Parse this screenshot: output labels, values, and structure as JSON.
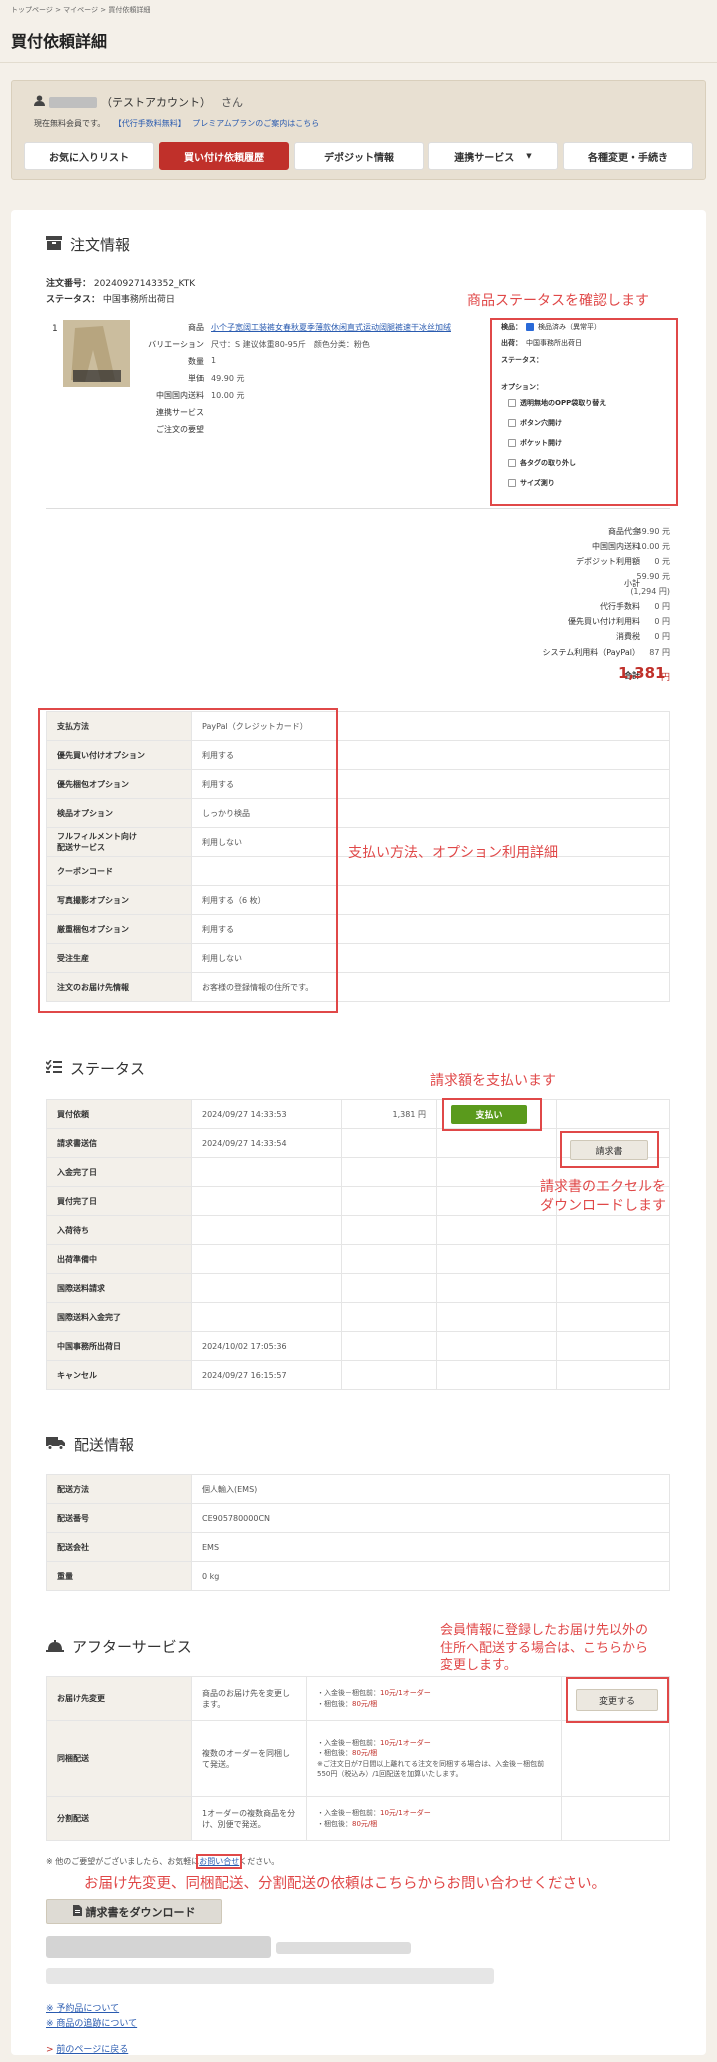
{
  "breadcrumb": "トップページ > マイページ > 買付依頼詳細",
  "page_title": "買付依頼詳細",
  "member": {
    "account_label": "（テストアカウント）",
    "honorific": "さん",
    "status_text": "現在無料会員です。",
    "fee_link": "【代行手数料無料】",
    "premium_link": "プレミアムプランのご案内はこちら"
  },
  "nav": [
    {
      "label": "お気に入りリスト"
    },
    {
      "label": "買い付け依頼履歴"
    },
    {
      "label": "デポジット情報"
    },
    {
      "label": "連携サービス"
    },
    {
      "label": "各種変更・手続き"
    }
  ],
  "order": {
    "section_title": "注文情報",
    "number_label": "注文番号：",
    "number": "20240927143352_KTK",
    "status_label": "ステータス：",
    "status": "中国事務所出荷日"
  },
  "product": {
    "index": "1",
    "labels": [
      "商品",
      "バリエーション",
      "数量",
      "単価",
      "中国国内送料",
      "連携サービス",
      "ご注文の要望"
    ],
    "name": "小个子宽阔工装裤女春秋夏季薄款休闲直式运动阔腿裤速干冰丝加绒",
    "variation": "尺寸：S 建议体重80-95斤　颜色分类：粉色",
    "quantity": "1",
    "unit_price": "49.90 元",
    "domestic_shipping": "10.00 元"
  },
  "item_status": {
    "inspection_label": "検品：",
    "inspection_value": "検品済み（異常平）",
    "shipping_label": "出荷：",
    "shipping_value": "中国事務所出荷日",
    "status_label": "ステータス：",
    "options_label": "オプション：",
    "options": [
      "透明無地のOPP袋取り替え",
      "ボタン穴開け",
      "ポケット開け",
      "各タグの取り外し",
      "サイズ測り"
    ]
  },
  "annotations": {
    "item_status": "商品ステータスを確認します",
    "payment": "支払い方法、オプション利用詳細",
    "pay": "請求額を支払います",
    "invoice": "請求書のエクセルを\nダウンロードします",
    "address": "会員情報に登録したお届け先以外の\n住所へ配送する場合は、こちらから\n変更します。",
    "inquiry": "お届け先変更、同梱配送、分割配送の依頼はこちらからお問い合わせください。"
  },
  "summary": {
    "rows": [
      {
        "label": "商品代金",
        "value": "49.90 元"
      },
      {
        "label": "中国国内送料",
        "value": "10.00 元"
      },
      {
        "label": "デポジット利用額",
        "value": "0 元"
      },
      {
        "label": "小計",
        "value": "59.90 元"
      },
      {
        "label": "",
        "value": "(1,294 円)"
      },
      {
        "label": "代行手数料",
        "value": "0 円"
      },
      {
        "label": "優先買い付け利用料",
        "value": "0 円"
      },
      {
        "label": "消費税",
        "value": "0 円"
      },
      {
        "label": "システム利用料（PayPal）",
        "value": "87 円"
      }
    ],
    "total_label": "合計",
    "total_value": "1,381",
    "total_unit": "円"
  },
  "payment_table": [
    {
      "k": "支払方法",
      "v": "PayPal（クレジットカード）"
    },
    {
      "k": "優先買い付けオプション",
      "v": "利用する"
    },
    {
      "k": "優先梱包オプション",
      "v": "利用する"
    },
    {
      "k": "検品オプション",
      "v": "しっかり検品"
    },
    {
      "k": "フルフィルメント向け\n配送サービス",
      "v": "利用しない"
    },
    {
      "k": "クーポンコード",
      "v": ""
    },
    {
      "k": "写真撮影オプション",
      "v": "利用する（6 枚）"
    },
    {
      "k": "厳重梱包オプション",
      "v": "利用する"
    },
    {
      "k": "受注生産",
      "v": "利用しない"
    },
    {
      "k": "注文のお届け先情報",
      "v": "お客様の登録情報の住所です。"
    }
  ],
  "status_section": {
    "title": "ステータス",
    "rows": [
      {
        "k": "買付依頼",
        "date": "2024/09/27 14:33:53",
        "amount": "1,381 円",
        "action": "支払い"
      },
      {
        "k": "請求書送信",
        "date": "2024/09/27 14:33:54",
        "amount": "",
        "action": "請求書"
      },
      {
        "k": "入金完了日",
        "date": "",
        "amount": "",
        "action": ""
      },
      {
        "k": "買付完了日",
        "date": "",
        "amount": "",
        "action": ""
      },
      {
        "k": "入荷待ち",
        "date": "",
        "amount": "",
        "action": ""
      },
      {
        "k": "出荷準備中",
        "date": "",
        "amount": "",
        "action": ""
      },
      {
        "k": "国際送料請求",
        "date": "",
        "amount": "",
        "action": ""
      },
      {
        "k": "国際送料入金完了",
        "date": "",
        "amount": "",
        "action": ""
      },
      {
        "k": "中国事務所出荷日",
        "date": "2024/10/02 17:05:36",
        "amount": "",
        "action": ""
      },
      {
        "k": "キャンセル",
        "date": "2024/09/27 16:15:57",
        "amount": "",
        "action": ""
      }
    ]
  },
  "delivery": {
    "title": "配送情報",
    "rows": [
      {
        "k": "配送方法",
        "v": "個人輸入(EMS)"
      },
      {
        "k": "配送番号",
        "v": "CE905780000CN"
      },
      {
        "k": "配送会社",
        "v": "EMS"
      },
      {
        "k": "重量",
        "v": "0 kg"
      }
    ]
  },
  "after": {
    "title": "アフターサービス",
    "rows": [
      {
        "k": "お届け先変更",
        "desc": "商品のお届け先を変更します。",
        "fee": [
          "・入金後－梱包前：10元/1オーダー",
          "・梱包後：80元/梱"
        ],
        "action": "変更する"
      },
      {
        "k": "同梱配送",
        "desc": "複数のオーダーを同梱して発送。",
        "fee": [
          "・入金後－梱包前：10元/1オーダー",
          "・梱包後：80元/梱",
          "※ご注文日が7日間以上離れてる注文を同梱する場合は、入金後－梱包前 550円（税込み）/1回配送を加算いたします。"
        ],
        "action": ""
      },
      {
        "k": "分割配送",
        "desc": "1オーダーの複数商品を分け、別便で発送。",
        "fee": [
          "・入金後－梱包前：10元/1オーダー",
          "・梱包後：80元/梱"
        ],
        "action": ""
      }
    ],
    "note_prefix": "※ 他のご要望がございましたら、お気軽に",
    "note_link": "お問い合せ",
    "note_suffix": "ください。"
  },
  "download_button": "請求書をダウンロード",
  "footer_links": [
    "※ 予約品について",
    "※ 商品の追跡について"
  ],
  "back_link": "前のページに戻る"
}
